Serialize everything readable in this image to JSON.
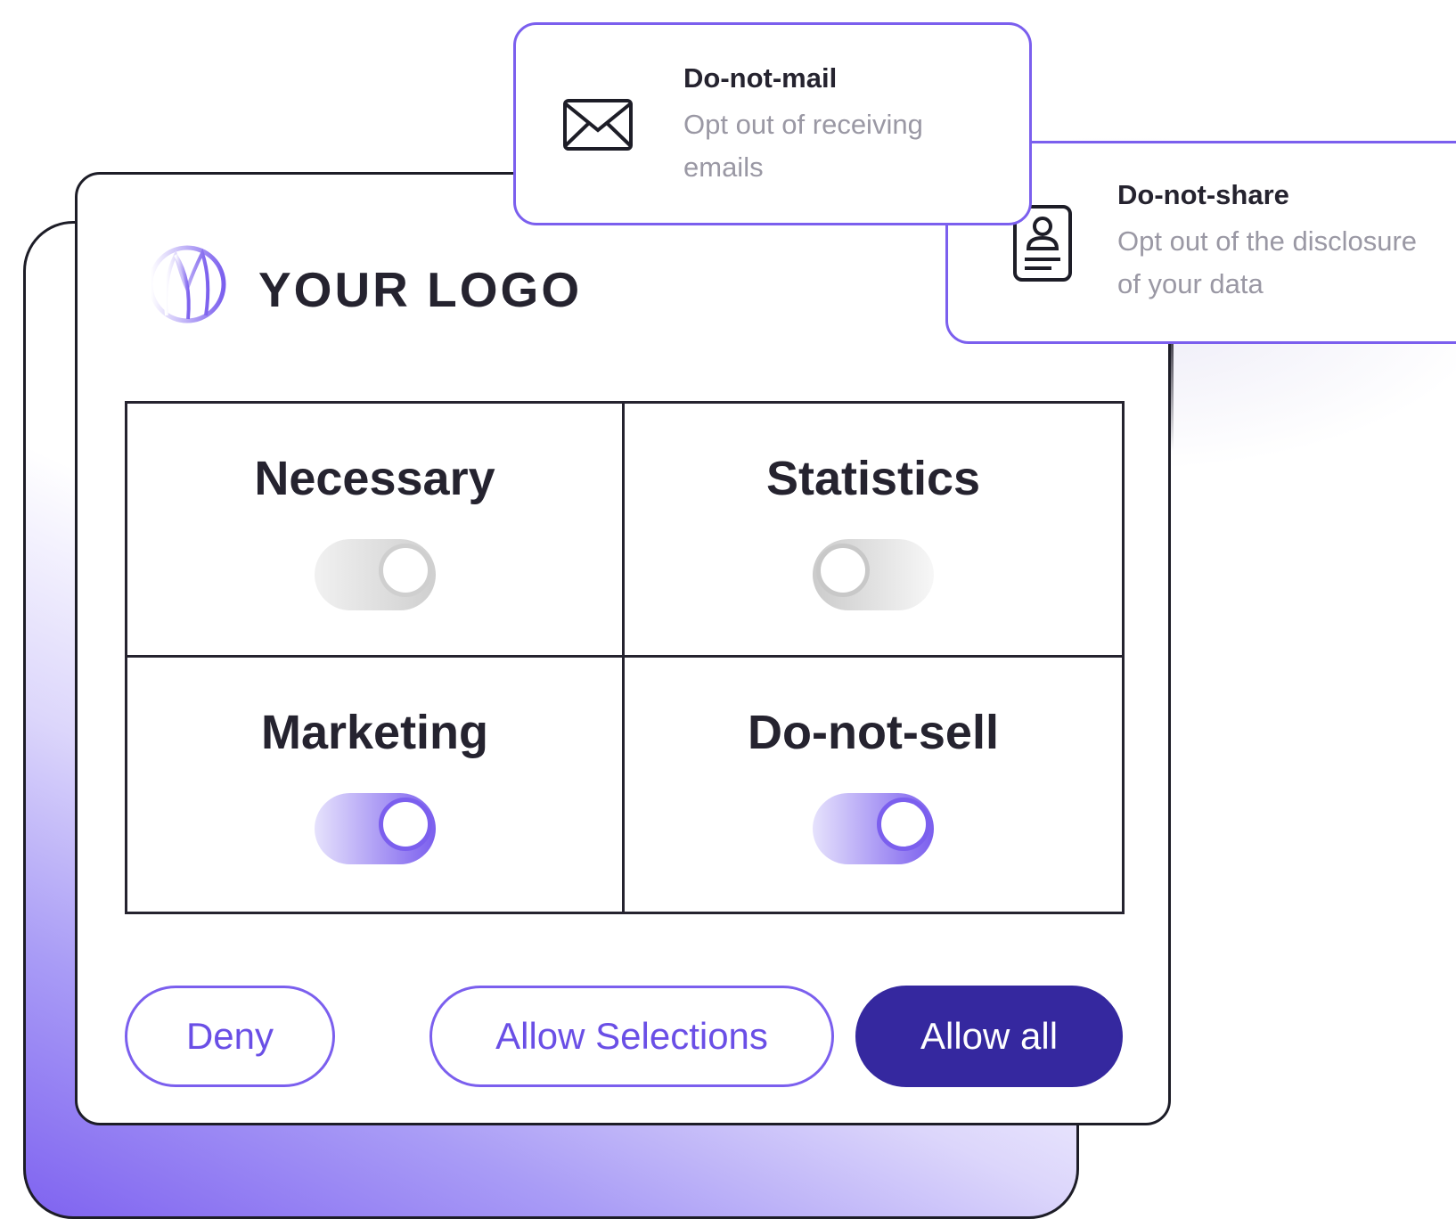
{
  "logo": {
    "text": "YOUR LOGO"
  },
  "categories": [
    {
      "label": "Necessary",
      "state": "on (locked)"
    },
    {
      "label": "Statistics",
      "state": "off"
    },
    {
      "label": "Marketing",
      "state": "on"
    },
    {
      "label": "Do-not-sell",
      "state": "on"
    }
  ],
  "buttons": {
    "deny": "Deny",
    "allow_selections": "Allow Selections",
    "allow_all": "Allow all"
  },
  "popups": {
    "mail": {
      "title": "Do-not-mail",
      "description": "Opt out of receiving emails",
      "icon": "envelope-icon"
    },
    "share": {
      "title": "Do-not-share",
      "description": "Opt out of the disclosure of your data",
      "icon": "id-card-icon"
    }
  },
  "colors": {
    "accent": "#7b5fee",
    "primary_button": "#35289f",
    "text_dark": "#25232f",
    "text_muted": "#9a98a4"
  }
}
